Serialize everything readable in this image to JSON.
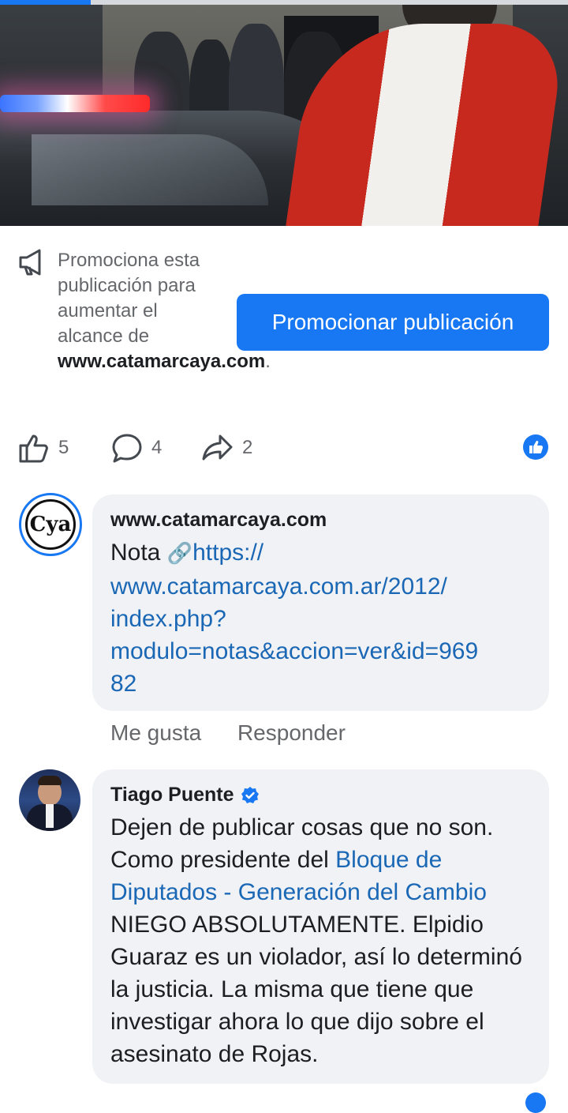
{
  "promote": {
    "text_before": "Promociona esta publicación para aumentar el alcance de ",
    "page_bold": "www.catamarcaya.com",
    "text_after": ".",
    "button_label": "Promocionar publicación"
  },
  "reactions": {
    "likes": "5",
    "comments": "4",
    "shares": "2"
  },
  "comments": [
    {
      "author": "www.catamarcaya.com",
      "avatar_text": "Cya",
      "text_prefix": "Nota ",
      "link_icon": "🔗",
      "link_text": "https://\nwww.catamarcaya.com.ar/2012/\nindex.php?\nmodulo=notas&accion=ver&id=969\n82",
      "like_label": "Me gusta",
      "reply_label": "Responder"
    },
    {
      "author": "Tiago Puente",
      "verified": true,
      "text_part1": "Dejen de publicar cosas que no son. Como presidente del ",
      "link_text": "Bloque de Diputados - Generación del Cambio",
      "text_part2": " NIEGO ABSOLUTAMENTE. Elpidio Guaraz es un violador, así lo determinó la justicia. La misma que tiene que investigar ahora lo que dijo sobre el asesinato de Rojas."
    }
  ],
  "colors": {
    "accent": "#1877f2",
    "link": "#1a67b5",
    "bubble": "#f0f2f5",
    "muted": "#65676b"
  },
  "video_progress": 0.16
}
